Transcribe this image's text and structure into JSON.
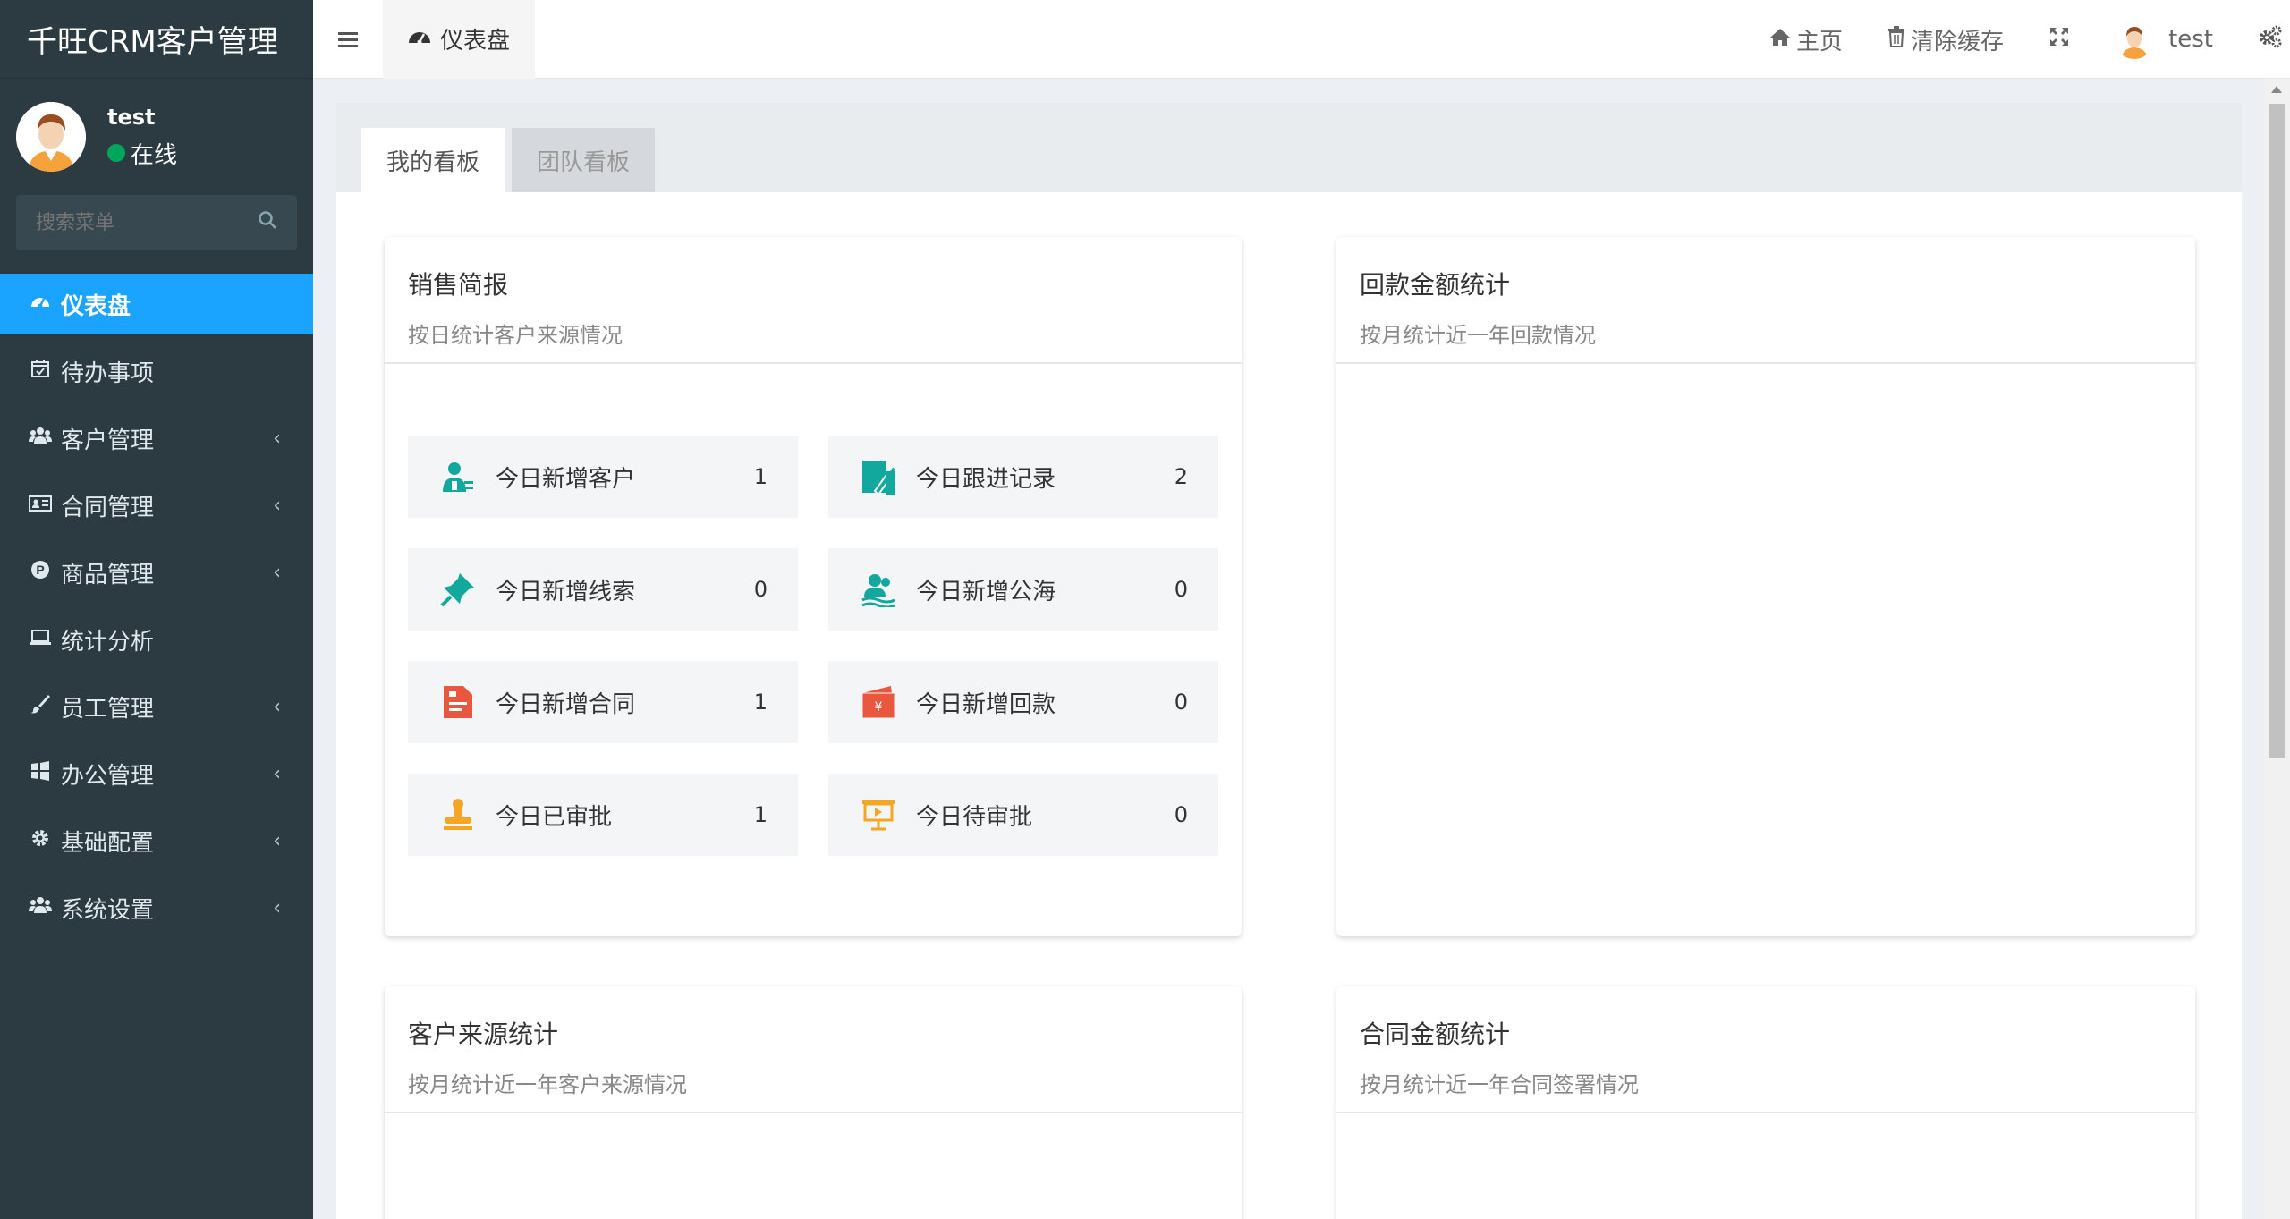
{
  "app": {
    "title": "千旺CRM客户管理"
  },
  "user": {
    "name": "test",
    "status": "在线"
  },
  "search": {
    "placeholder": "搜索菜单"
  },
  "menu": [
    {
      "label": "仪表盘",
      "icon": "dashboard-icon",
      "active": true
    },
    {
      "label": "待办事项",
      "icon": "calendar-check-icon"
    },
    {
      "label": "客户管理",
      "icon": "users-icon",
      "submenu": true
    },
    {
      "label": "合同管理",
      "icon": "id-card-icon",
      "submenu": true
    },
    {
      "label": "商品管理",
      "icon": "product-icon",
      "submenu": true
    },
    {
      "label": "统计分析",
      "icon": "laptop-icon"
    },
    {
      "label": "员工管理",
      "icon": "brush-icon",
      "submenu": true
    },
    {
      "label": "办公管理",
      "icon": "windows-icon",
      "submenu": true
    },
    {
      "label": "基础配置",
      "icon": "gear-icon",
      "submenu": true
    },
    {
      "label": "系统设置",
      "icon": "users-icon",
      "submenu": true
    }
  ],
  "header": {
    "tab_label": "仪表盘",
    "home_label": "主页",
    "clear_cache_label": "清除缓存",
    "user_name": "test"
  },
  "board_tabs": {
    "mine": "我的看板",
    "team": "团队看板"
  },
  "cards": {
    "sales": {
      "title": "销售简报",
      "subtitle": "按日统计客户来源情况"
    },
    "payment": {
      "title": "回款金额统计",
      "subtitle": "按月统计近一年回款情况"
    },
    "source": {
      "title": "客户来源统计",
      "subtitle": "按月统计近一年客户来源情况"
    },
    "contract": {
      "title": "合同金额统计",
      "subtitle": "按月统计近一年合同签署情况"
    }
  },
  "stats": [
    {
      "label": "今日新增客户",
      "value": "1",
      "icon": "customer-icon",
      "color": "#13a89e"
    },
    {
      "label": "今日跟进记录",
      "value": "2",
      "icon": "edit-record-icon",
      "color": "#13a89e"
    },
    {
      "label": "今日新增线索",
      "value": "0",
      "icon": "pin-icon",
      "color": "#13a89e"
    },
    {
      "label": "今日新增公海",
      "value": "0",
      "icon": "public-pool-icon",
      "color": "#13a89e"
    },
    {
      "label": "今日新增合同",
      "value": "1",
      "icon": "contract-icon",
      "color": "#e9573f"
    },
    {
      "label": "今日新增回款",
      "value": "0",
      "icon": "payment-icon",
      "color": "#e9573f"
    },
    {
      "label": "今日已审批",
      "value": "1",
      "icon": "stamp-icon",
      "color": "#f5a623"
    },
    {
      "label": "今日待审批",
      "value": "0",
      "icon": "pending-approval-icon",
      "color": "#f5a623"
    }
  ],
  "colors": {
    "sidebar": "#2c3b41",
    "accent": "#1aa3ff",
    "online": "#00a65a"
  }
}
